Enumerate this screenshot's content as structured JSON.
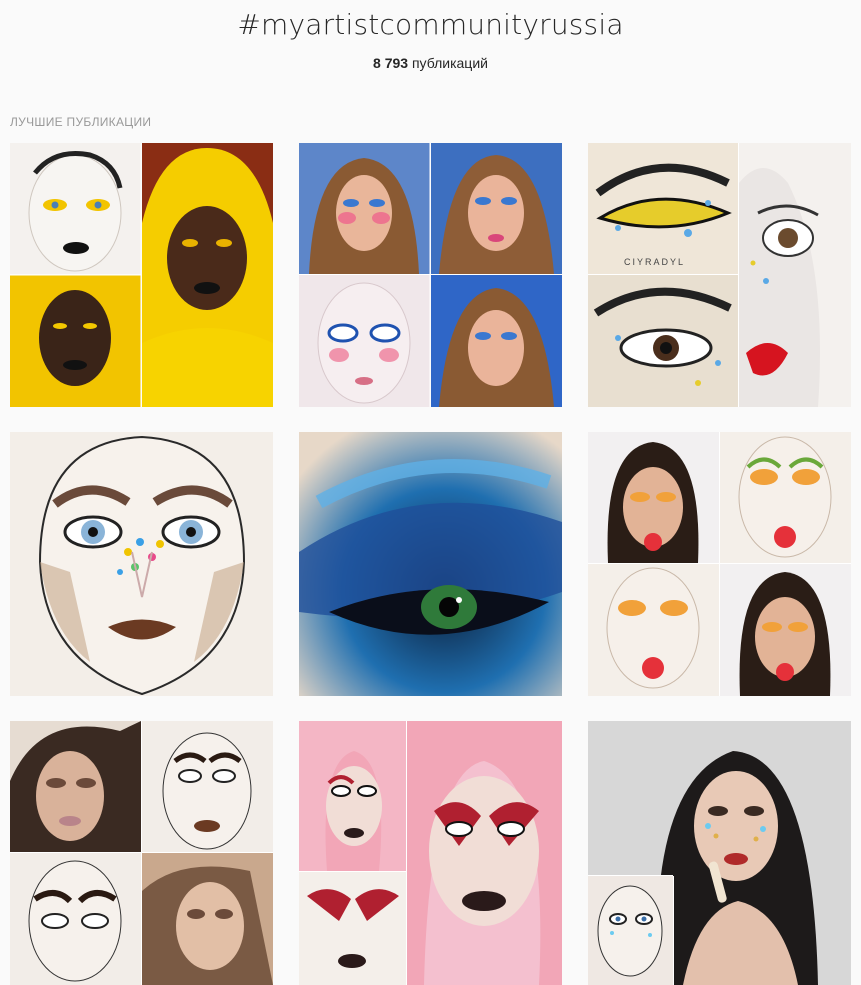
{
  "header": {
    "hashtag": "#myartistcommunityrussia",
    "post_count": "8 793",
    "post_count_label": "публикаций"
  },
  "section": {
    "top_posts_label": "ЛУЧШИЕ ПУБЛИКАЦИИ"
  },
  "posts": [
    {
      "name": "post-1",
      "kind": "collage-4",
      "palette": [
        "#f5f3f0",
        "#f2c400",
        "#3a2a1a",
        "#f7d300"
      ],
      "watermark": ""
    },
    {
      "name": "post-2",
      "kind": "collage-4",
      "palette": [
        "#7aa3e6",
        "#d9a27a",
        "#f0e7ea",
        "#2f66c7"
      ],
      "watermark": ""
    },
    {
      "name": "post-3",
      "kind": "collage-3",
      "palette": [
        "#efe6d8",
        "#e9e2de",
        "#f4f0ea",
        "#e3d9c8"
      ],
      "watermark": "CIYRADYL"
    },
    {
      "name": "post-4",
      "kind": "face-sketch",
      "palette": [
        "#f3eee8",
        "#d9c0a8",
        "#6a4a3a",
        "#8ab4d8"
      ],
      "watermark": ""
    },
    {
      "name": "post-5",
      "kind": "eye-closeup",
      "palette": [
        "#0b1a33",
        "#1f6fb0",
        "#6bb7e6",
        "#e7d8c8"
      ],
      "watermark": ""
    },
    {
      "name": "post-6",
      "kind": "collage-4",
      "palette": [
        "#f4efe9",
        "#f1a13a",
        "#6aa83a",
        "#e5313a"
      ],
      "watermark": ""
    },
    {
      "name": "post-7",
      "kind": "collage-4",
      "palette": [
        "#e6dcd2",
        "#c9a88d",
        "#f2ede8",
        "#6b4a3a"
      ],
      "watermark": ""
    },
    {
      "name": "post-8",
      "kind": "collage-4",
      "palette": [
        "#f2a6b7",
        "#f4c0cf",
        "#b02030",
        "#2a1a1a"
      ],
      "watermark": ""
    },
    {
      "name": "post-9",
      "kind": "collage-2",
      "palette": [
        "#d7d7d7",
        "#1d1a1a",
        "#e8c9b6",
        "#6ccbf0"
      ],
      "watermark": ""
    }
  ]
}
